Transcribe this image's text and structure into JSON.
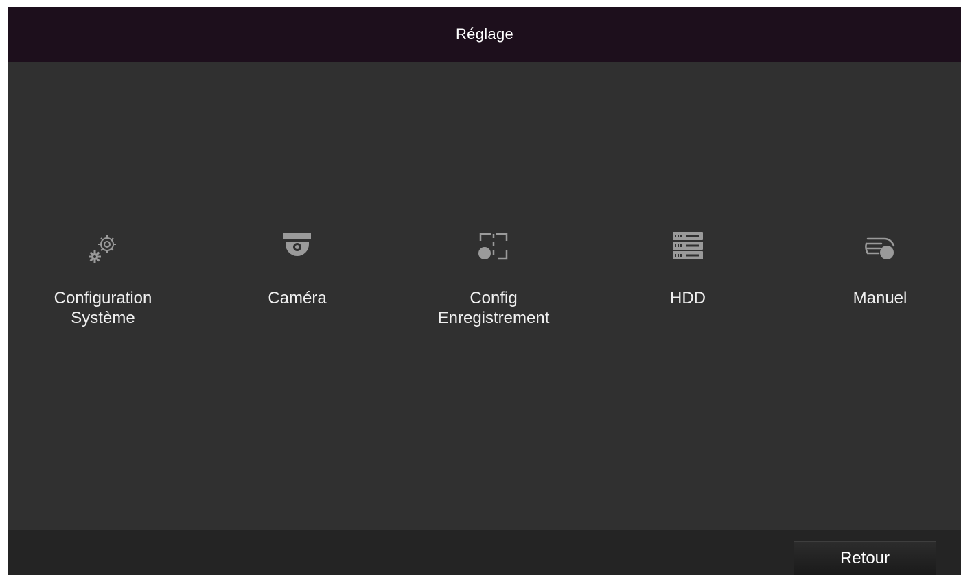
{
  "window": {
    "title": "Réglage"
  },
  "menu": {
    "items": [
      {
        "line1": "Configuration",
        "line2": "Système",
        "icon": "gears-icon"
      },
      {
        "line1": "Caméra",
        "line2": "",
        "icon": "dome-camera-icon"
      },
      {
        "line1": "Config",
        "line2": "Enregistrement",
        "icon": "record-config-icon"
      },
      {
        "line1": "HDD",
        "line2": "",
        "icon": "hdd-icon"
      },
      {
        "line1": "Manuel",
        "line2": "",
        "icon": "manual-record-icon"
      }
    ]
  },
  "footer": {
    "back_label": "Retour"
  },
  "colors": {
    "title_bar": "#1d0f1c",
    "background": "#303030",
    "footer": "#242424",
    "icon": "#9a9a9a",
    "text": "#f0f0f0"
  }
}
